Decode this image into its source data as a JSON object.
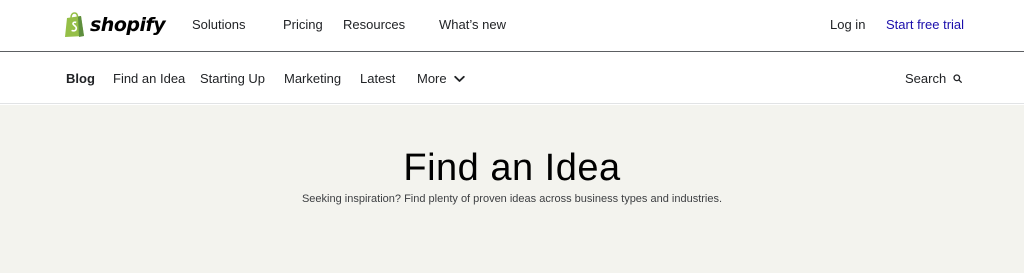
{
  "topbar": {
    "logo_text": "shopify",
    "nav": [
      "Solutions",
      "Pricing",
      "Resources",
      "What’s new"
    ],
    "login": "Log in",
    "trial": "Start free trial"
  },
  "subnav": {
    "items": [
      "Blog",
      "Find an Idea",
      "Starting Up",
      "Marketing",
      "Latest"
    ],
    "more": "More",
    "search": "Search"
  },
  "hero": {
    "title": "Find an Idea",
    "subtitle": "Seeking inspiration? Find plenty of proven ideas across business types and industries."
  },
  "colors": {
    "brand_green": "#95bf47",
    "link_blue": "#1a0dab",
    "hero_bg": "#f3f3ee"
  },
  "icons": [
    "shopify-bag-icon",
    "chevron-down-icon",
    "search-icon"
  ]
}
